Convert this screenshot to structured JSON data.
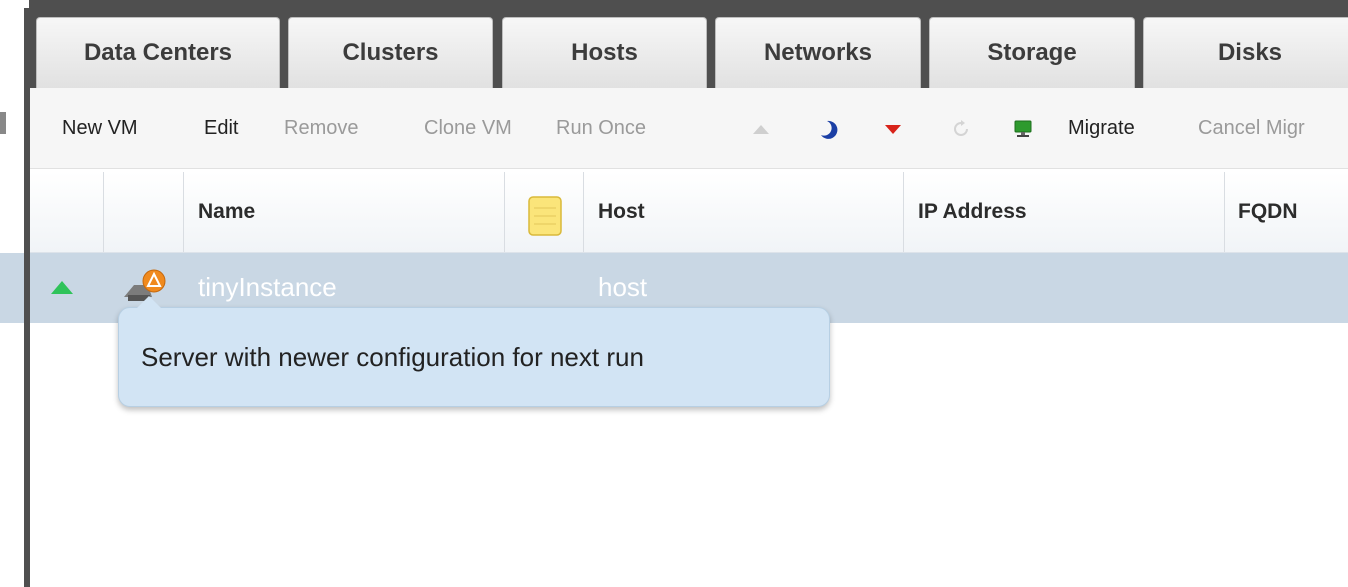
{
  "tabs": [
    {
      "label": "Data Centers"
    },
    {
      "label": "Clusters"
    },
    {
      "label": "Hosts"
    },
    {
      "label": "Networks"
    },
    {
      "label": "Storage"
    },
    {
      "label": "Disks"
    }
  ],
  "toolbar": {
    "new_vm": "New VM",
    "edit": "Edit",
    "remove": "Remove",
    "clone_vm": "Clone VM",
    "run_once": "Run Once",
    "migrate": "Migrate",
    "cancel_migration": "Cancel Migr",
    "icons": [
      "run-up-arrow-icon",
      "suspend-moon-icon",
      "shutdown-down-arrow-icon",
      "reboot-icon",
      "console-monitor-icon"
    ]
  },
  "grid": {
    "columns": {
      "name": "Name",
      "host": "Host",
      "ip_address": "IP Address",
      "fqdn": "FQDN"
    },
    "rows": [
      {
        "status_icon": "up-triangle-icon",
        "type_icon": "server-next-run-icon",
        "name": "tinyInstance",
        "host": "host"
      }
    ]
  },
  "tooltip": {
    "text": "Server with newer configuration for next run"
  },
  "colors": {
    "frame": "#4f4f4f",
    "selected_row": "#c9d7e4",
    "tooltip_bg": "#d2e4f4",
    "status_up": "#2fc35a",
    "shutdown_red": "#d8231a",
    "suspend_blue": "#1b3fa5"
  }
}
